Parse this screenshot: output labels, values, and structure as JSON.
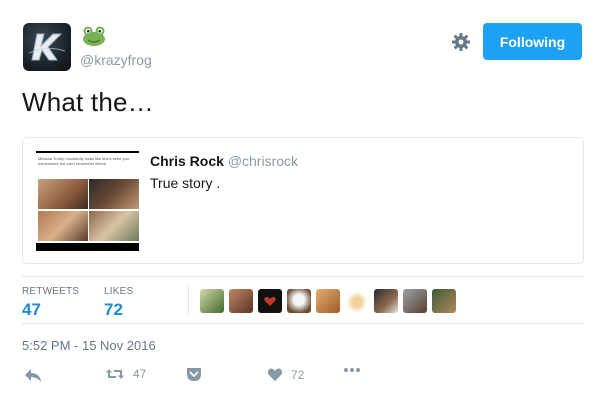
{
  "author": {
    "handle": "@krazyfrog",
    "avatar_icon": "krazyfrog-k-logo",
    "emoji_icon": "frog-emoji"
  },
  "header": {
    "settings_icon": "gear-icon",
    "follow_label": "Following"
  },
  "tweet": {
    "text": "What the…"
  },
  "quoted": {
    "name": "Chris Rock",
    "handle": "@chrisrock",
    "text": "True story .",
    "thumb_caption": "Melania Trump constantly looks like she's seen you somewhere but can't remember where."
  },
  "stats": {
    "retweets_label": "RETWEETS",
    "retweets_value": "47",
    "likes_label": "LIKES",
    "likes_value": "72",
    "liker_avatar_count": 9
  },
  "timestamp": "5:52 PM - 15 Nov 2016",
  "actions": {
    "reply_icon": "reply-icon",
    "retweet_icon": "retweet-icon",
    "retweet_count": "47",
    "pocket_icon": "pocket-icon",
    "like_icon": "heart-icon",
    "like_count": "72",
    "more_icon": "more-icon"
  },
  "colors": {
    "accent": "#1da1f2",
    "stat_value": "#1d8ad1",
    "muted": "#8899a6",
    "border": "#e1e8ed"
  }
}
